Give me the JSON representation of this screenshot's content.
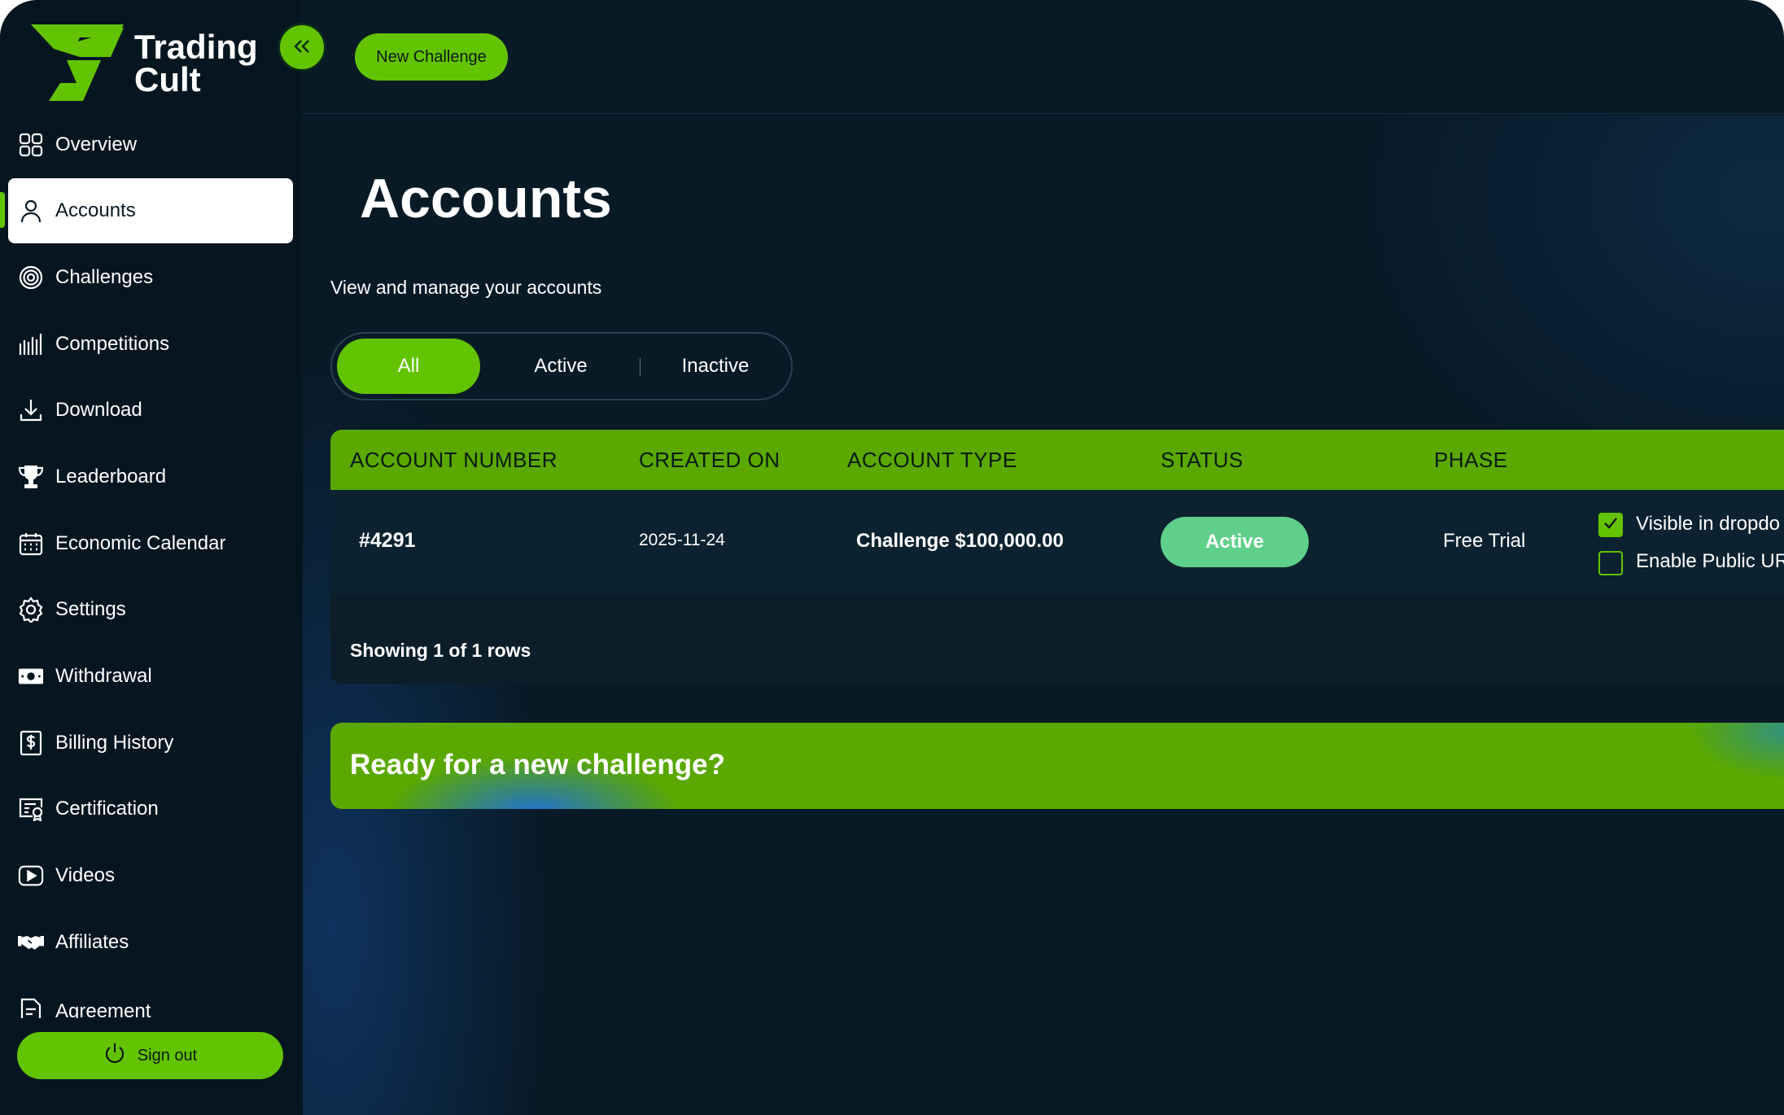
{
  "brand": {
    "name": "Trading\nCult",
    "accent": "#62c400"
  },
  "topbar": {
    "new_challenge_label": "New Challenge",
    "collapse_icon": "chevrons-left-icon"
  },
  "sidebar": {
    "items": [
      {
        "label": "Overview",
        "icon": "grid-icon"
      },
      {
        "label": "Accounts",
        "icon": "user-icon",
        "active": true
      },
      {
        "label": "Challenges",
        "icon": "target-icon"
      },
      {
        "label": "Competitions",
        "icon": "bars-icon"
      },
      {
        "label": "Download",
        "icon": "download-icon"
      },
      {
        "label": "Leaderboard",
        "icon": "trophy-icon"
      },
      {
        "label": "Economic Calendar",
        "icon": "calendar-icon"
      },
      {
        "label": "Settings",
        "icon": "gear-icon"
      },
      {
        "label": "Withdrawal",
        "icon": "cash-icon"
      },
      {
        "label": "Billing History",
        "icon": "dollar-doc-icon"
      },
      {
        "label": "Certification",
        "icon": "certificate-icon"
      },
      {
        "label": "Videos",
        "icon": "play-icon"
      },
      {
        "label": "Affiliates",
        "icon": "handshake-icon"
      },
      {
        "label": "Agreement",
        "icon": "document-icon"
      }
    ],
    "signout_label": "Sign out"
  },
  "main": {
    "title": "Accounts",
    "subtitle": "View and manage your accounts",
    "filters": [
      "All",
      "Active",
      "Inactive"
    ],
    "selected_filter": "All",
    "table": {
      "columns": [
        "ACCOUNT NUMBER",
        "CREATED ON",
        "ACCOUNT TYPE",
        "STATUS",
        "PHASE"
      ],
      "rows": [
        {
          "account_number": "#4291",
          "created_on": "2025-11-24",
          "account_type": "Challenge $100,000.00",
          "status": "Active",
          "phase": "Free Trial",
          "option_visible_label": "Visible in dropdo",
          "option_visible_checked": true,
          "option_public_label": "Enable Public UR",
          "option_public_checked": false
        }
      ],
      "footer": "Showing 1 of 1 rows"
    },
    "banner_text": "Ready for a new challenge?"
  }
}
